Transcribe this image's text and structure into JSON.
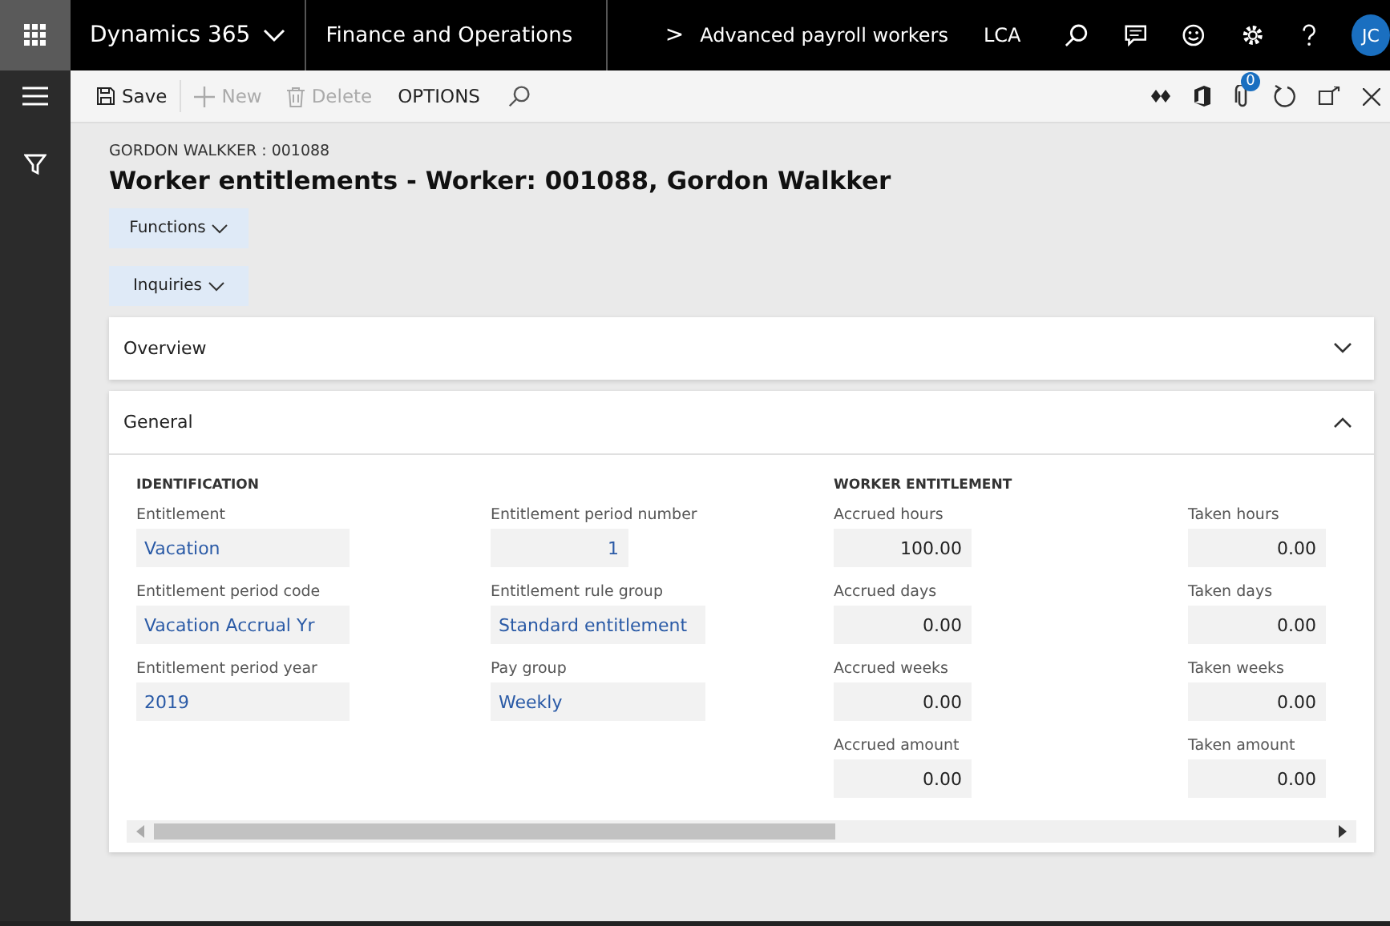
{
  "nav": {
    "product": "Dynamics 365",
    "app": "Finance and Operations",
    "breadcrumb_caret": ">",
    "breadcrumb": "Advanced payroll workers",
    "company": "LCA",
    "avatar": "JC"
  },
  "toolbar": {
    "buttons": [
      {
        "kind": "save",
        "label": "Save",
        "disabled": false
      },
      {
        "kind": "new",
        "label": "New",
        "disabled": true
      },
      {
        "kind": "delete",
        "label": "Delete",
        "disabled": true
      },
      {
        "kind": "text",
        "label": "OPTIONS",
        "disabled": false
      }
    ],
    "attach_count": "0"
  },
  "page": {
    "caption": "GORDON WALKKER : 001088",
    "title": "Worker entitlements - Worker: 001088, Gordon Walkker",
    "menus": [
      "Functions",
      "Inquiries"
    ]
  },
  "sections": [
    {
      "title": "Overview",
      "expanded": false
    },
    {
      "title": "General",
      "expanded": true
    }
  ],
  "groups": [
    {
      "title": "IDENTIFICATION",
      "columns": [
        [
          {
            "label": "Entitlement",
            "value": "Vacation",
            "kind": "text"
          },
          {
            "label": "Entitlement period code",
            "value": "Vacation Accrual Yr",
            "kind": "text"
          },
          {
            "label": "Entitlement period year",
            "value": "2019",
            "kind": "text"
          }
        ],
        [
          {
            "label": "Entitlement period number",
            "value": "1",
            "kind": "number"
          },
          {
            "label": "Entitlement rule group",
            "value": "Standard entitlement",
            "kind": "text"
          },
          {
            "label": "Pay group",
            "value": "Weekly",
            "kind": "text"
          }
        ]
      ]
    },
    {
      "title": "WORKER ENTITLEMENT",
      "columns": [
        [
          {
            "label": "Accrued hours",
            "value": "100.00",
            "kind": "number"
          },
          {
            "label": "Accrued days",
            "value": "0.00",
            "kind": "number"
          },
          {
            "label": "Accrued weeks",
            "value": "0.00",
            "kind": "number"
          },
          {
            "label": "Accrued amount",
            "value": "0.00",
            "kind": "number"
          }
        ],
        [
          {
            "label": "Taken hours",
            "value": "0.00",
            "kind": "number"
          },
          {
            "label": "Taken days",
            "value": "0.00",
            "kind": "number"
          },
          {
            "label": "Taken weeks",
            "value": "0.00",
            "kind": "number"
          },
          {
            "label": "Taken amount",
            "value": "0.00",
            "kind": "number"
          }
        ]
      ]
    }
  ]
}
